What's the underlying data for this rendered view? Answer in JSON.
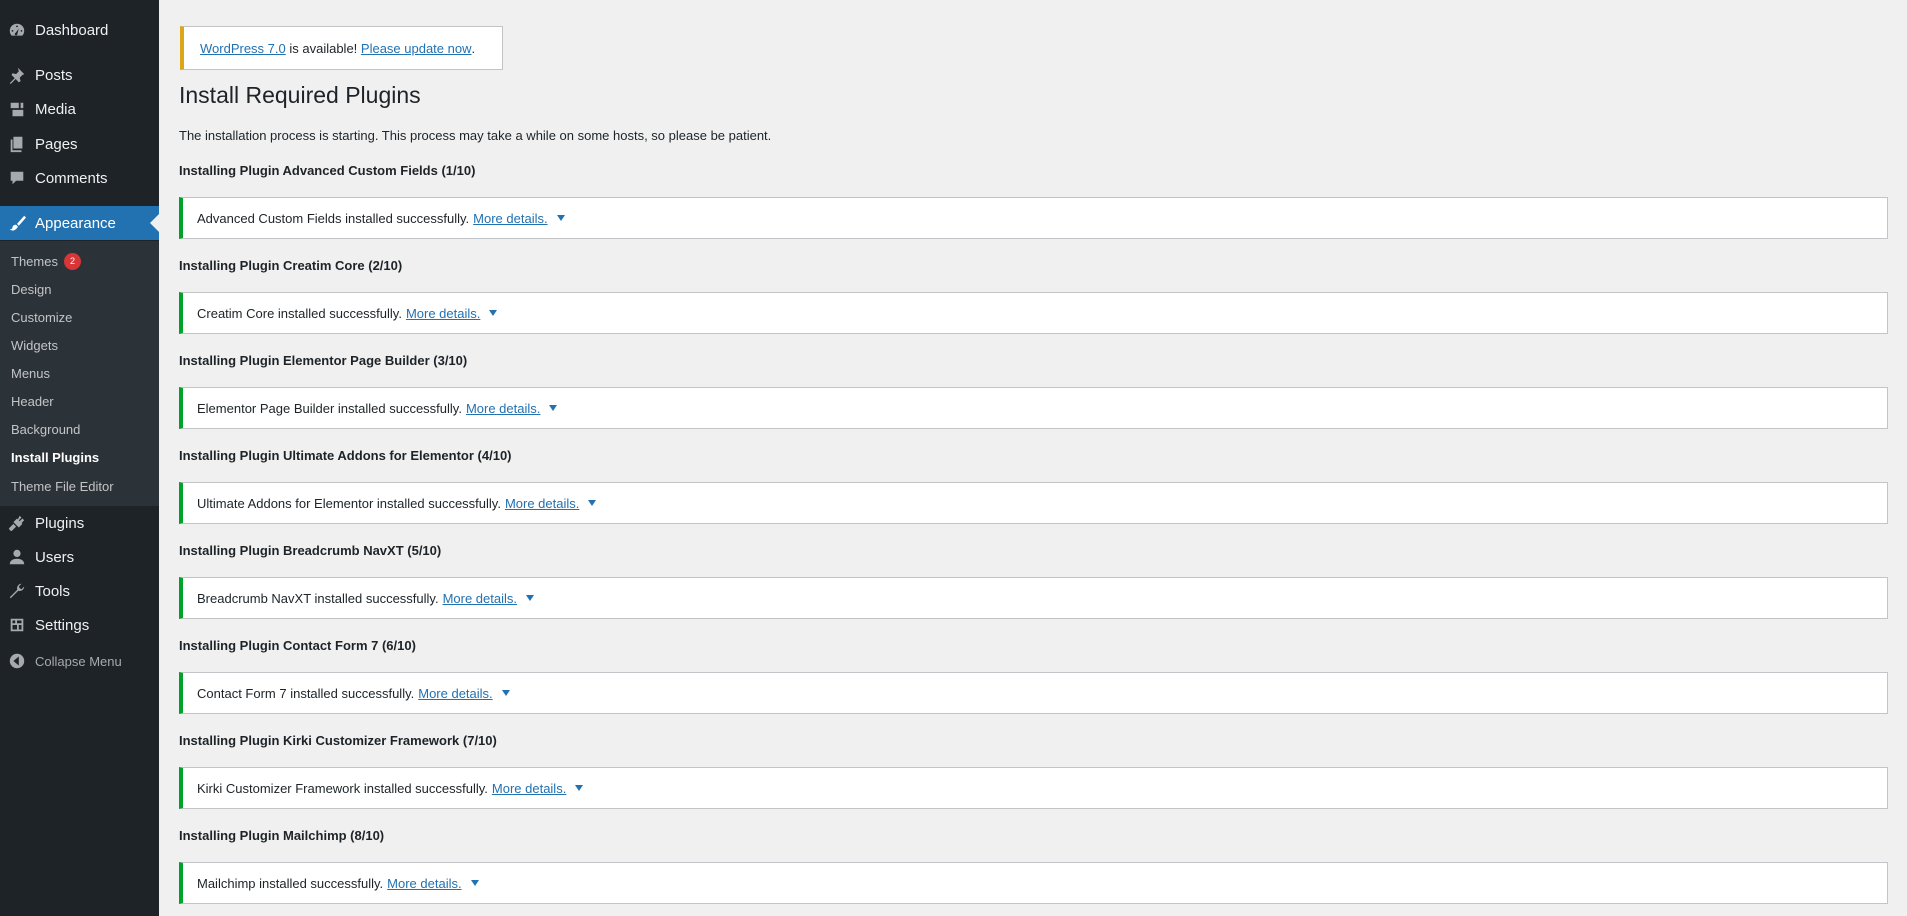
{
  "menu": {
    "dashboard": "Dashboard",
    "posts": "Posts",
    "media": "Media",
    "pages": "Pages",
    "comments": "Comments",
    "appearance": "Appearance",
    "plugins": "Plugins",
    "users": "Users",
    "tools": "Tools",
    "settings": "Settings",
    "collapse": "Collapse Menu"
  },
  "submenu": {
    "themes": "Themes",
    "themes_badge": "2",
    "design": "Design",
    "customize": "Customize",
    "widgets": "Widgets",
    "menus": "Menus",
    "header": "Header",
    "background": "Background",
    "install_plugins": "Install Plugins",
    "theme_file_editor": "Theme File Editor"
  },
  "nag": {
    "version_link": "WordPress 7.0",
    "middle": " is available! ",
    "update_link": "Please update now",
    "end": "."
  },
  "page": {
    "title": "Install Required Plugins",
    "intro": "The installation process is starting. This process may take a while on some hosts, so please be patient."
  },
  "more_details": "More details.",
  "steps": [
    {
      "title": "Installing Plugin Advanced Custom Fields (1/10)",
      "message": "Advanced Custom Fields installed successfully."
    },
    {
      "title": "Installing Plugin Creatim Core (2/10)",
      "message": "Creatim Core installed successfully."
    },
    {
      "title": "Installing Plugin Elementor Page Builder (3/10)",
      "message": "Elementor Page Builder installed successfully."
    },
    {
      "title": "Installing Plugin Ultimate Addons for Elementor (4/10)",
      "message": "Ultimate Addons for Elementor installed successfully."
    },
    {
      "title": "Installing Plugin Breadcrumb NavXT (5/10)",
      "message": "Breadcrumb NavXT installed successfully."
    },
    {
      "title": "Installing Plugin Contact Form 7 (6/10)",
      "message": "Contact Form 7 installed successfully."
    },
    {
      "title": "Installing Plugin Kirki Customizer Framework (7/10)",
      "message": "Kirki Customizer Framework installed successfully."
    },
    {
      "title": "Installing Plugin Mailchimp (8/10)",
      "message": "Mailchimp installed successfully."
    }
  ],
  "colors": {
    "sidebar": "#1d2327",
    "submenu": "#2c3338",
    "accent": "#2271b1",
    "success": "#00a32a",
    "warning": "#dba617",
    "badge": "#d63638"
  }
}
